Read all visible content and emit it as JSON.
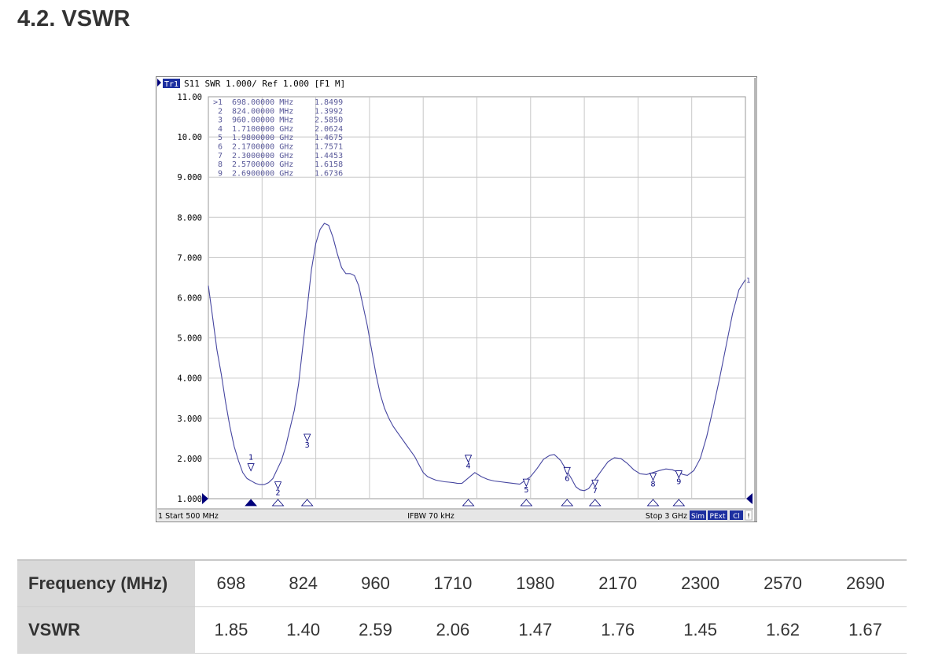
{
  "section_title": "4.2. VSWR",
  "analyzer": {
    "trace_tag": "Tr1",
    "header_text": "S11  SWR 1.000/ Ref 1.000 [F1 M]",
    "footer_start": "1 Start 500 MHz",
    "footer_center": "IFBW 70 kHz",
    "footer_stop": "Stop 3 GHz",
    "status_badges": [
      "Sim",
      "PExt",
      "Cl",
      "!"
    ],
    "end_marker_label": "1",
    "colors": {
      "trace": "#4646a0",
      "grid": "#c8c8c8",
      "marker": "#00007a",
      "badge_bg": "#1c2fa0"
    },
    "marker_table": [
      {
        "id": ">1",
        "freq": "698.00000 MHz",
        "value": "1.8499"
      },
      {
        "id": "2",
        "freq": "824.00000 MHz",
        "value": "1.3992"
      },
      {
        "id": "3",
        "freq": "960.00000 MHz",
        "value": "2.5850"
      },
      {
        "id": "4",
        "freq": "1.7100000 GHz",
        "value": "2.0624"
      },
      {
        "id": "5",
        "freq": "1.9800000 GHz",
        "value": "1.4675"
      },
      {
        "id": "6",
        "freq": "2.1700000 GHz",
        "value": "1.7571"
      },
      {
        "id": "7",
        "freq": "2.3000000 GHz",
        "value": "1.4453"
      },
      {
        "id": "8",
        "freq": "2.5700000 GHz",
        "value": "1.6158"
      },
      {
        "id": "9",
        "freq": "2.6900000 GHz",
        "value": "1.6736"
      }
    ]
  },
  "chart_data": {
    "type": "line",
    "title": "",
    "xlabel": "",
    "ylabel": "",
    "x_unit": "MHz",
    "xlim": [
      500,
      3000
    ],
    "ylim": [
      1,
      11
    ],
    "grid": true,
    "y_ticks": [
      "11.00",
      "10.00",
      "9.000",
      "8.000",
      "7.000",
      "6.000",
      "5.000",
      "4.000",
      "3.000",
      "2.000",
      "1.000"
    ],
    "series": [
      {
        "x": [
          500,
          520,
          540,
          560,
          580,
          600,
          620,
          640,
          660,
          680,
          698,
          720,
          740,
          760,
          780,
          800,
          824,
          840,
          860,
          880,
          900,
          920,
          940,
          960,
          980,
          1000,
          1020,
          1040,
          1060,
          1080,
          1100,
          1120,
          1140,
          1160,
          1180,
          1200,
          1220,
          1240,
          1260,
          1280,
          1300,
          1320,
          1340,
          1360,
          1380,
          1400,
          1420,
          1440,
          1460,
          1480,
          1500,
          1520,
          1540,
          1560,
          1580,
          1600,
          1620,
          1640,
          1660,
          1680,
          1710,
          1740,
          1770,
          1800,
          1830,
          1860,
          1890,
          1920,
          1950,
          1980,
          2000,
          2030,
          2060,
          2090,
          2110,
          2140,
          2170,
          2190,
          2210,
          2230,
          2250,
          2270,
          2300,
          2330,
          2360,
          2390,
          2420,
          2450,
          2480,
          2510,
          2540,
          2570,
          2600,
          2630,
          2660,
          2690,
          2710,
          2730,
          2760,
          2790,
          2820,
          2850,
          2880,
          2910,
          2940,
          2970,
          3000
        ],
        "y": [
          6.3,
          5.5,
          4.7,
          4.1,
          3.4,
          2.8,
          2.3,
          1.95,
          1.65,
          1.5,
          1.85,
          1.38,
          1.35,
          1.35,
          1.4,
          1.5,
          1.4,
          1.95,
          2.3,
          2.75,
          3.2,
          3.85,
          4.8,
          2.59,
          6.7,
          7.35,
          7.7,
          7.85,
          7.8,
          7.5,
          7.1,
          6.75,
          6.6,
          6.6,
          6.55,
          6.3,
          5.8,
          5.3,
          4.7,
          4.1,
          3.6,
          3.25,
          3.0,
          2.8,
          2.65,
          2.5,
          2.35,
          2.2,
          2.05,
          1.85,
          1.65,
          1.55,
          1.5,
          1.46,
          1.44,
          1.42,
          1.41,
          1.4,
          1.38,
          1.38,
          2.06,
          1.65,
          1.55,
          1.48,
          1.44,
          1.42,
          1.4,
          1.38,
          1.36,
          1.47,
          1.55,
          1.75,
          1.98,
          2.08,
          2.1,
          1.95,
          1.76,
          1.5,
          1.3,
          1.22,
          1.2,
          1.25,
          1.45,
          1.7,
          1.92,
          2.02,
          2.0,
          1.88,
          1.72,
          1.62,
          1.6,
          1.62,
          1.7,
          1.74,
          1.72,
          1.67,
          1.6,
          1.58,
          1.7,
          2.0,
          2.55,
          3.25,
          4.0,
          4.8,
          5.6,
          6.2,
          6.45
        ]
      }
    ],
    "markers": [
      {
        "id": "1",
        "x": 698,
        "y": 1.8499
      },
      {
        "id": "2",
        "x": 824,
        "y": 1.3992
      },
      {
        "id": "3",
        "x": 960,
        "y": 2.585
      },
      {
        "id": "4",
        "x": 1710,
        "y": 2.0624
      },
      {
        "id": "5",
        "x": 1980,
        "y": 1.4675
      },
      {
        "id": "6",
        "x": 2170,
        "y": 1.7571
      },
      {
        "id": "7",
        "x": 2300,
        "y": 1.4453
      },
      {
        "id": "8",
        "x": 2570,
        "y": 1.6158
      },
      {
        "id": "9",
        "x": 2690,
        "y": 1.6736
      }
    ]
  },
  "summary_table": {
    "frequency_label": "Frequency (MHz)",
    "vswr_label": "VSWR",
    "frequencies": [
      "698",
      "824",
      "960",
      "1710",
      "1980",
      "2170",
      "2300",
      "2570",
      "2690"
    ],
    "vswr": [
      "1.85",
      "1.40",
      "2.59",
      "2.06",
      "1.47",
      "1.76",
      "1.45",
      "1.62",
      "1.67"
    ]
  }
}
